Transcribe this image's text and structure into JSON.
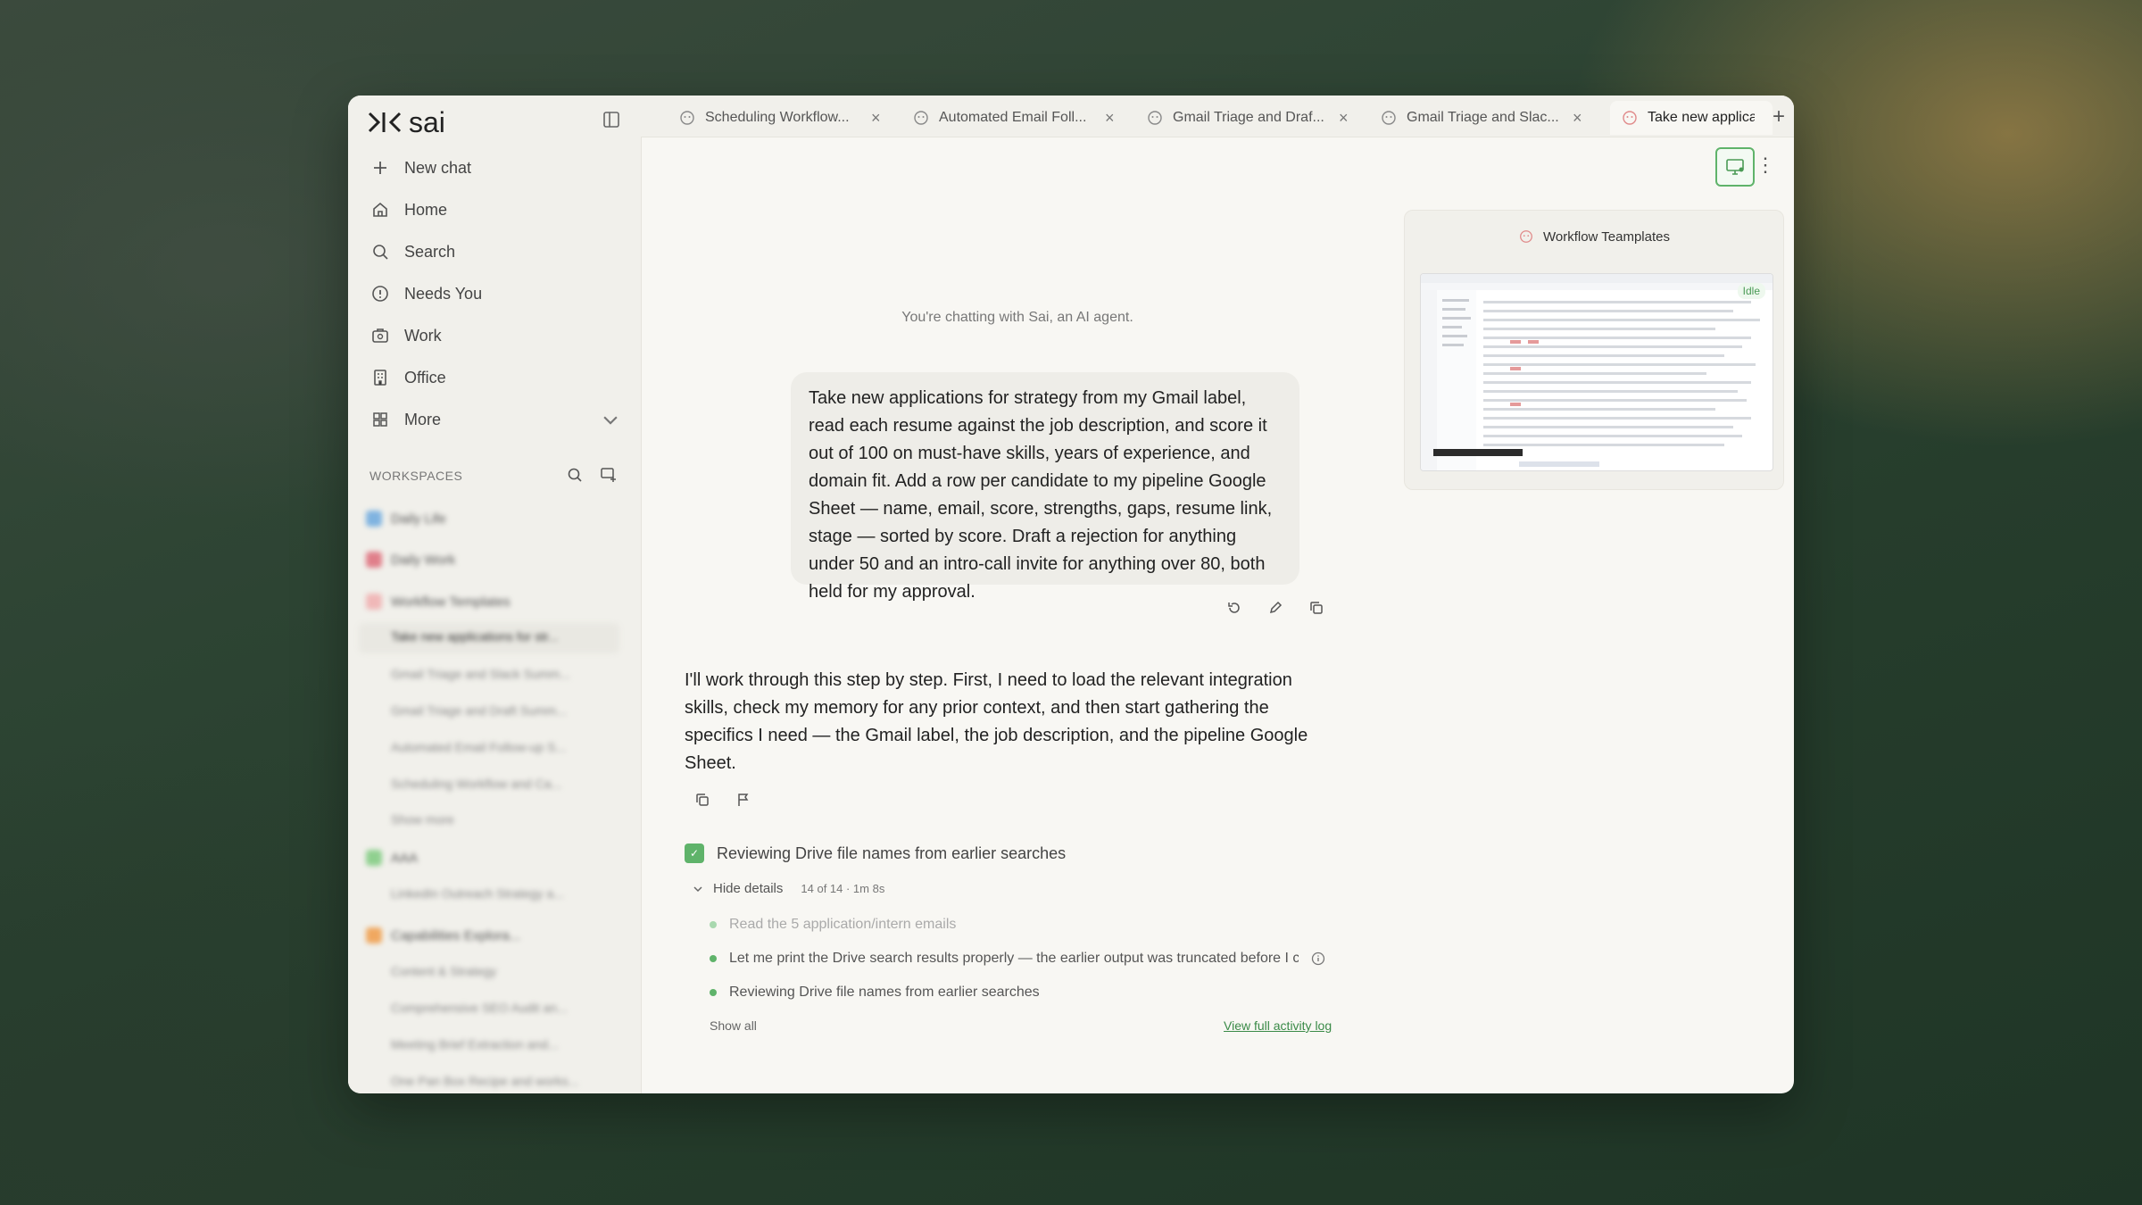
{
  "app": {
    "logo_mark": ">|<",
    "logo_text": "sai"
  },
  "sidebar": {
    "nav": [
      {
        "label": "New chat",
        "icon": "plus-icon"
      },
      {
        "label": "Home",
        "icon": "home-icon"
      },
      {
        "label": "Search",
        "icon": "search-icon"
      },
      {
        "label": "Needs You",
        "icon": "alert-circle-icon"
      },
      {
        "label": "Work",
        "icon": "briefcase-icon"
      },
      {
        "label": "Office",
        "icon": "building-icon"
      },
      {
        "label": "More",
        "icon": "grid-icon"
      }
    ],
    "workspaces_header": "WORKSPACES",
    "workspaces": [
      {
        "label": "Daily Life",
        "color": "#7fb3e0"
      },
      {
        "label": "Daily Work",
        "color": "#e07f8a"
      },
      {
        "label": "Workflow Templates",
        "color": "#f0b8b8"
      },
      {
        "label": "Take new applications for str...",
        "sub": true
      },
      {
        "label": "Gmail Triage and Slack Summ...",
        "sub": true
      },
      {
        "label": "Gmail Triage and Draft Summ...",
        "sub": true
      },
      {
        "label": "Automated Email Follow-up S...",
        "sub": true
      },
      {
        "label": "Scheduling Workflow and Ca...",
        "sub": true
      },
      {
        "label": "Show more",
        "sub": true
      },
      {
        "label": "AAA",
        "color": "#8fd08f"
      },
      {
        "label": "LinkedIn Outreach Strategy a...",
        "sub": true
      },
      {
        "label": "Capabilities Explora...",
        "color": "#f0a860"
      },
      {
        "label": "Content & Strategy",
        "sub": true
      },
      {
        "label": "Comprehensive SEO Audit an...",
        "sub": true
      },
      {
        "label": "Meeting Brief Extraction and...",
        "sub": true
      },
      {
        "label": "One Pan Box Recipe and works...",
        "sub": true
      }
    ]
  },
  "tabs": [
    {
      "label": "Scheduling Workflow..."
    },
    {
      "label": "Automated Email Foll..."
    },
    {
      "label": "Gmail Triage and Draf..."
    },
    {
      "label": "Gmail Triage and Slac..."
    },
    {
      "label": "Take new applica",
      "active": true
    }
  ],
  "preview": {
    "title": "Workflow Teamplates",
    "status": "Idle"
  },
  "chat": {
    "intro": "You're chatting with Sai, an AI agent.",
    "user_message": "Take new applications for strategy from my Gmail label, read each resume against the job description, and score it out of 100 on must-have skills, years of experience, and domain fit. Add a row per candidate to my pipeline Google Sheet — name, email, score, strengths, gaps, resume link, stage — sorted by score. Draft a rejection for anything under 50 and an intro-call invite for anything over 80, both held for my approval.",
    "assistant_message": "I'll work through this step by step. First, I need to load the relevant integration skills, check my memory for any prior context, and then start gathering the specifics I need — the Gmail label, the job description, and the pipeline Google Sheet.",
    "step_title": "Reviewing Drive file names from earlier searches",
    "details_toggle": "Hide details",
    "details_meta": "14 of 14 · 1m 8s",
    "sub_steps": [
      "Read the 5 application/intern emails",
      "Let me print the Drive search results properly — the earlier output was truncated before I co...",
      "Reviewing Drive file names from earlier searches"
    ],
    "show_all": "Show all",
    "view_log": "View full activity log"
  }
}
